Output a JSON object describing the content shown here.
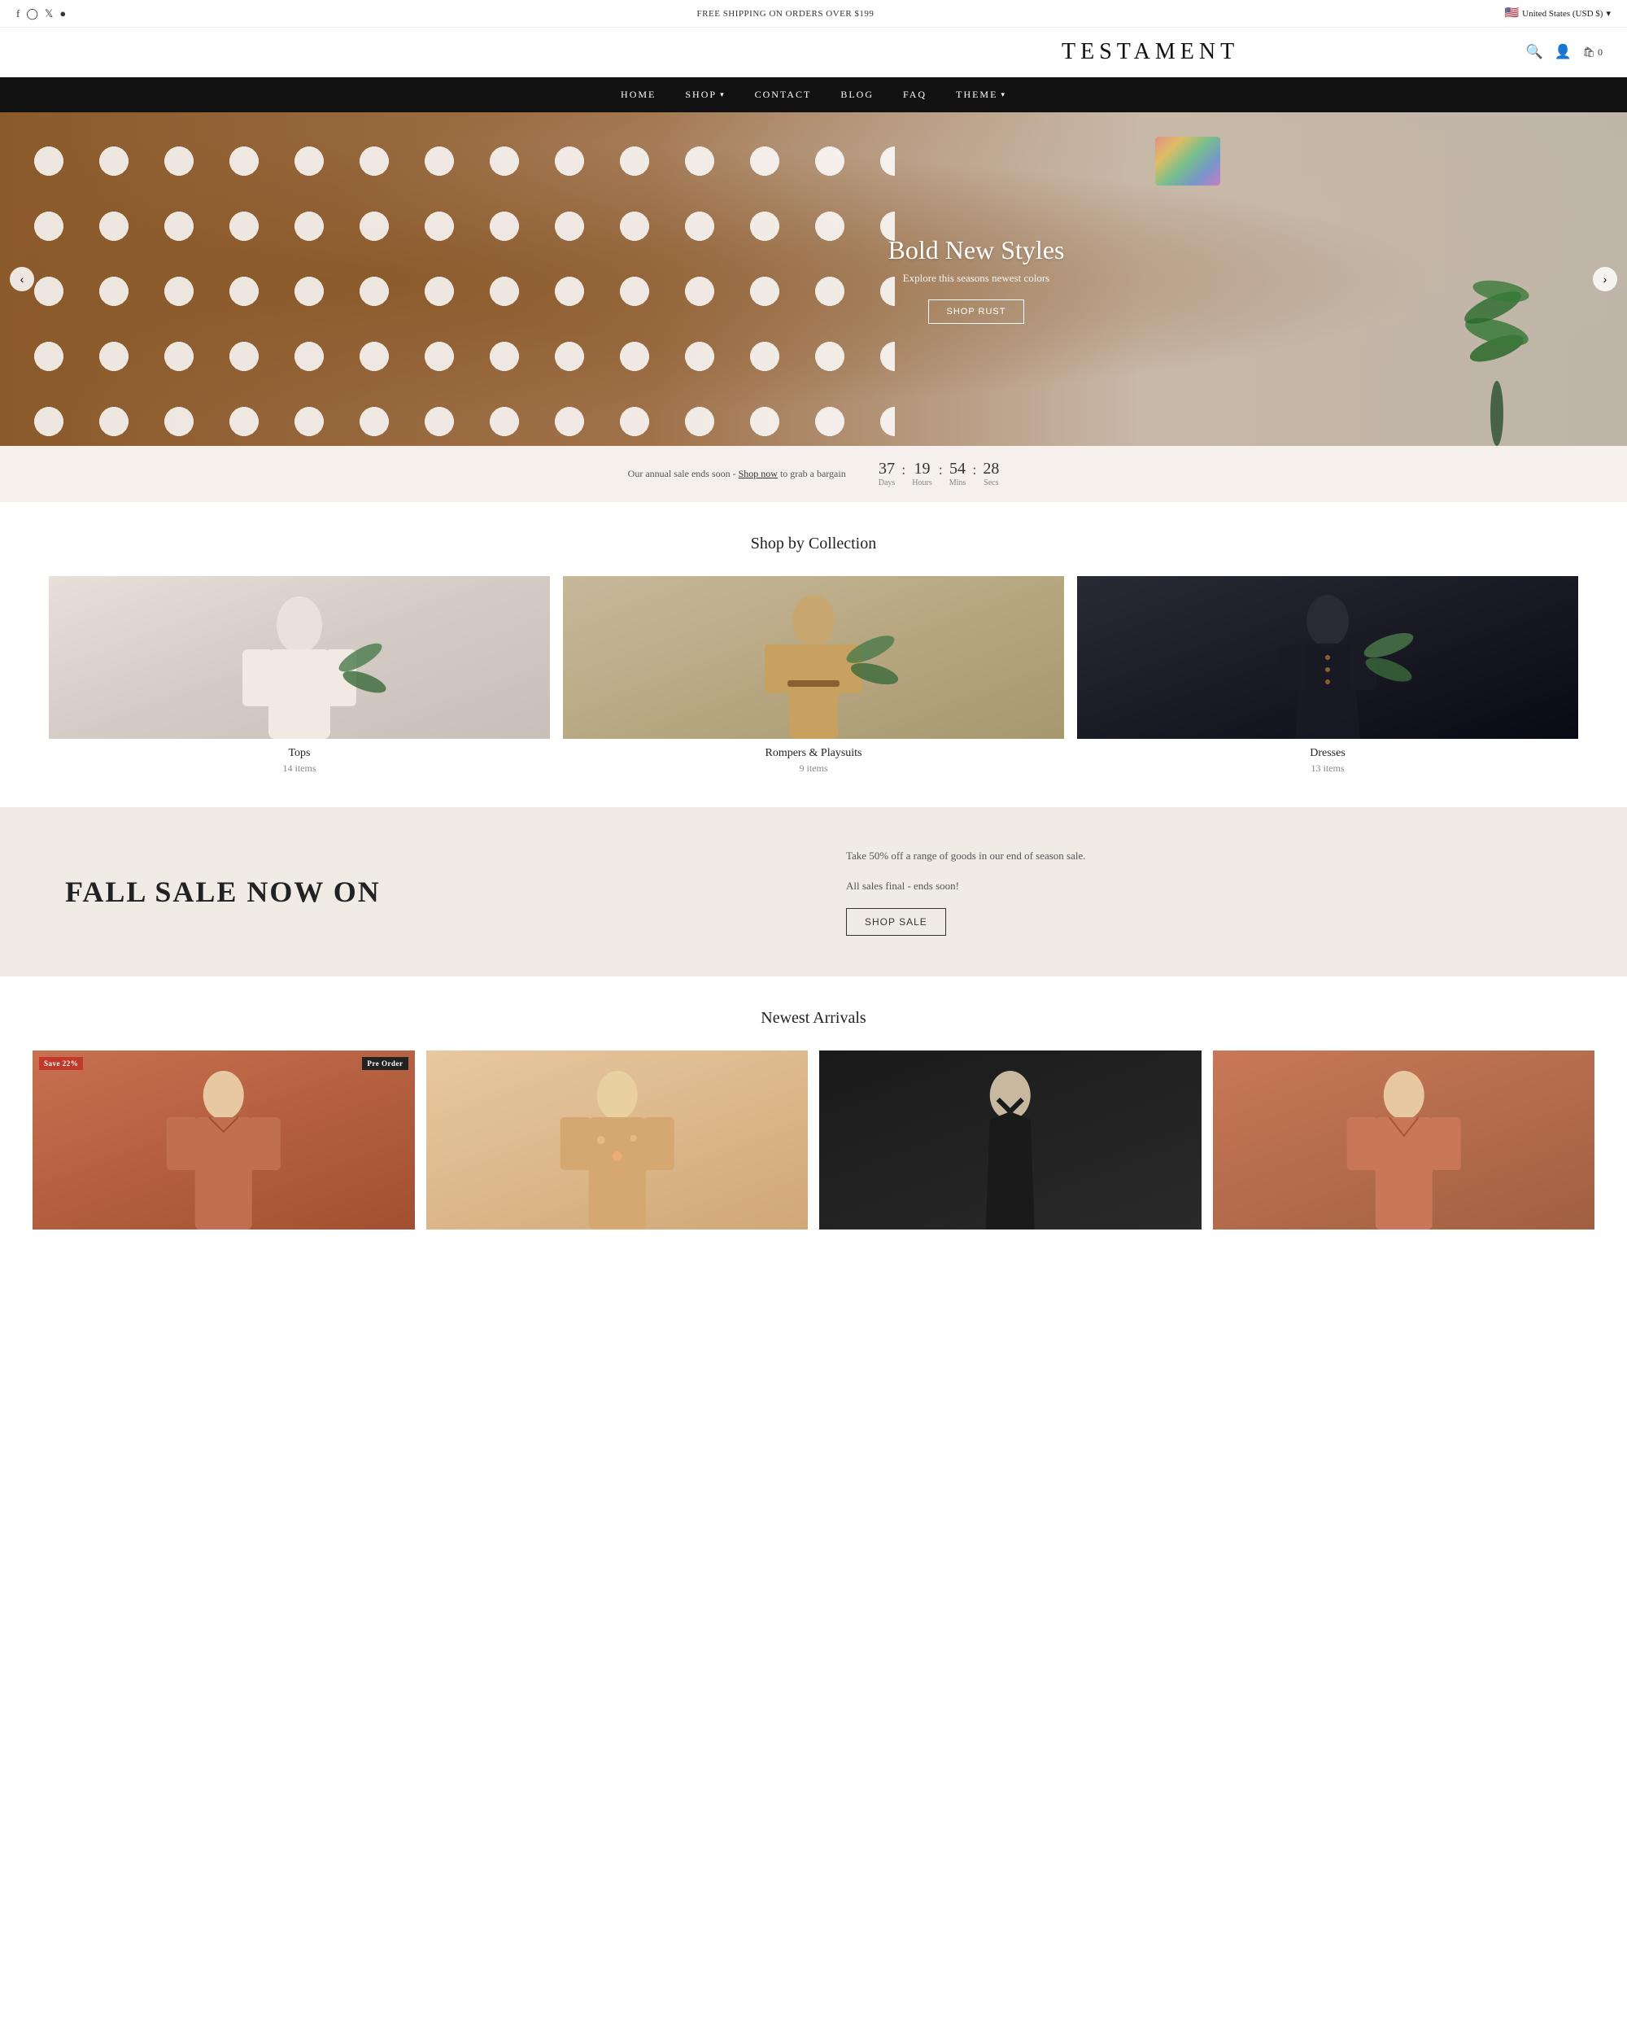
{
  "topbar": {
    "shipping_notice": "FREE SHIPPING ON ORDERS OVER $199",
    "region": "United States (USD $)",
    "social": [
      "facebook",
      "instagram",
      "twitter",
      "pinterest"
    ]
  },
  "header": {
    "logo": "TESTAMENT",
    "cart_count": "0"
  },
  "nav": {
    "items": [
      {
        "label": "HOME",
        "has_dropdown": false
      },
      {
        "label": "SHOP",
        "has_dropdown": true
      },
      {
        "label": "CONTACT",
        "has_dropdown": false
      },
      {
        "label": "BLOG",
        "has_dropdown": false
      },
      {
        "label": "FAQ",
        "has_dropdown": false
      },
      {
        "label": "THEME",
        "has_dropdown": true
      }
    ]
  },
  "hero": {
    "title": "Bold New Styles",
    "subtitle": "Explore this seasons newest colors",
    "cta_label": "Shop Rust",
    "prev_label": "‹",
    "next_label": "›"
  },
  "countdown": {
    "text_before": "Our annual sale ends soon -",
    "link_text": "Shop now",
    "text_after": "to grab a bargain",
    "days": "37",
    "hours": "19",
    "mins": "54",
    "secs": "28",
    "label_days": "Days",
    "label_hours": "Hours",
    "label_mins": "Mins",
    "label_secs": "Secs"
  },
  "collections": {
    "section_title": "Shop by Collection",
    "items": [
      {
        "name": "Tops",
        "count": "14 items"
      },
      {
        "name": "Rompers & Playsuits",
        "count": "9 items"
      },
      {
        "name": "Dresses",
        "count": "13 items"
      }
    ]
  },
  "sale_banner": {
    "title": "FALL SALE NOW ON",
    "description_line1": "Take 50% off a range of goods in our end of season sale.",
    "description_line2": "All sales final - ends soon!",
    "cta_label": "Shop Sale"
  },
  "newest_arrivals": {
    "section_title": "Newest Arrivals",
    "products": [
      {
        "badge_sale": "Save 22%",
        "badge_preorder": "Pre Order"
      },
      {},
      {},
      {}
    ]
  }
}
